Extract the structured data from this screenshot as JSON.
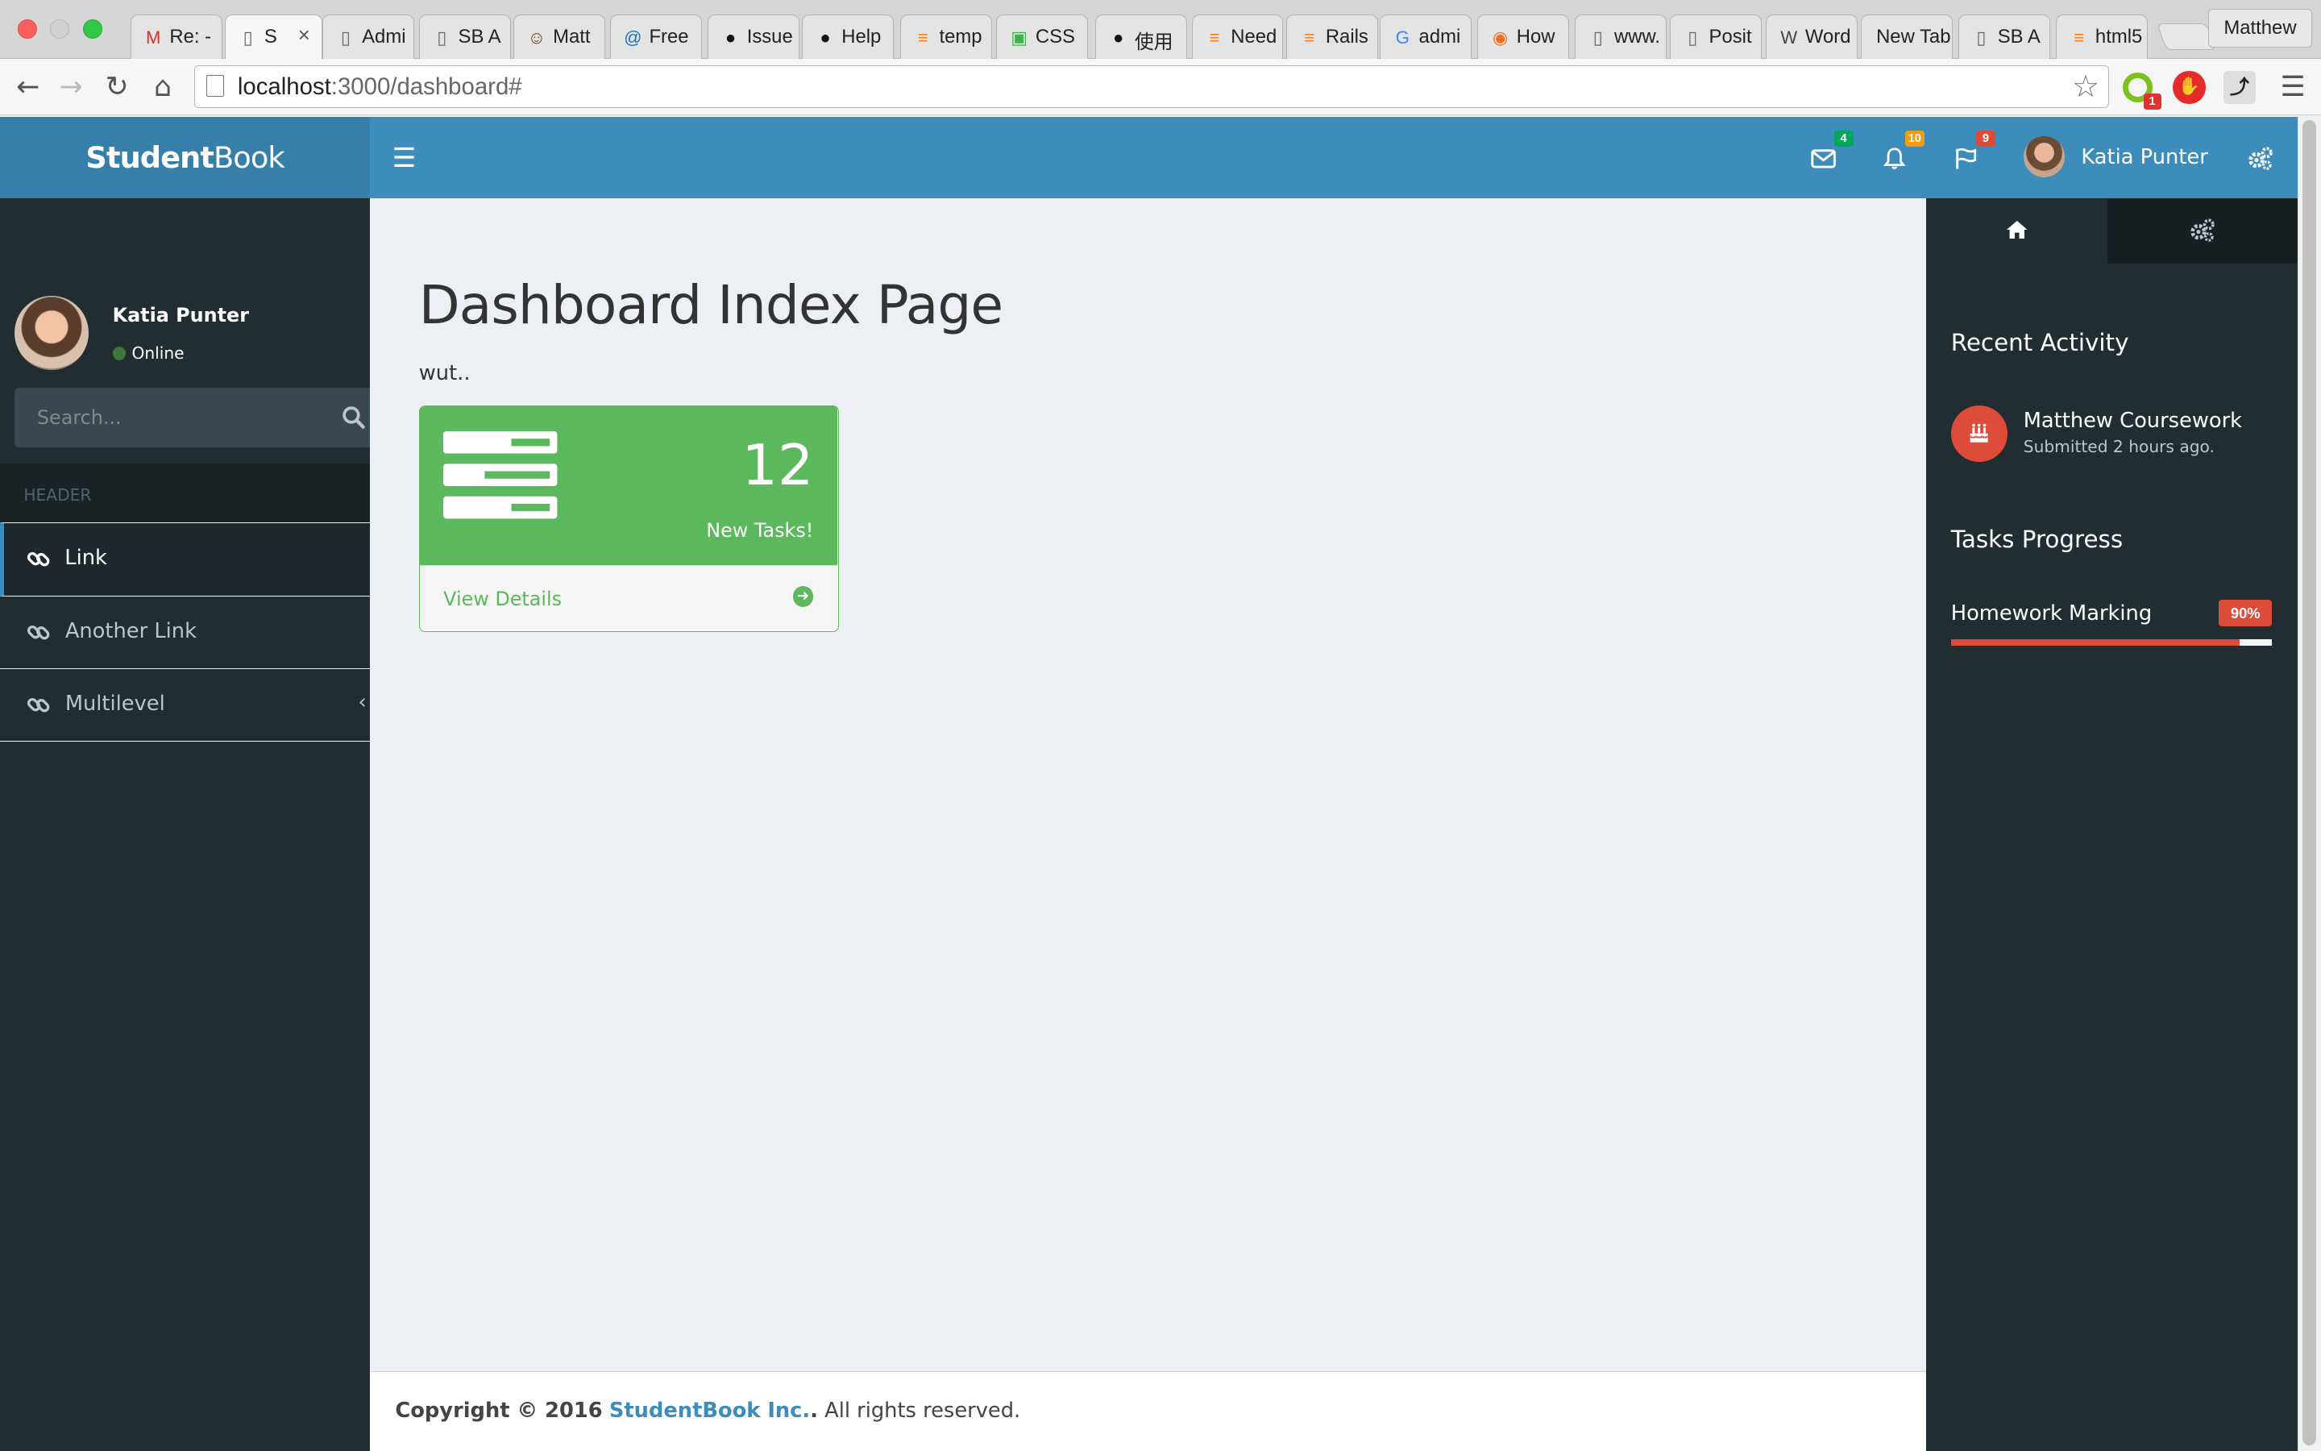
{
  "browser": {
    "tabs": [
      {
        "label": "Re: -",
        "icon": "gmail-icon"
      },
      {
        "label": "S",
        "icon": "page-icon",
        "active": true
      },
      {
        "label": "Admi",
        "icon": "page-icon"
      },
      {
        "label": "SB A",
        "icon": "page-icon"
      },
      {
        "label": "Matt",
        "icon": "avatar-icon"
      },
      {
        "label": "Free",
        "icon": "at-icon"
      },
      {
        "label": "Issue",
        "icon": "github-icon"
      },
      {
        "label": "Help",
        "icon": "github-icon"
      },
      {
        "label": "temp",
        "icon": "stackoverflow-icon"
      },
      {
        "label": "CSS",
        "icon": "css-icon"
      },
      {
        "label": "使用",
        "icon": "github-icon"
      },
      {
        "label": "Need",
        "icon": "stackoverflow-icon"
      },
      {
        "label": "Rails",
        "icon": "stackoverflow-icon"
      },
      {
        "label": "admi",
        "icon": "google-icon"
      },
      {
        "label": "How",
        "icon": "orange-icon"
      },
      {
        "label": "www.",
        "icon": "page-icon"
      },
      {
        "label": "Posit",
        "icon": "page-icon"
      },
      {
        "label": "Word",
        "icon": "wordpress-icon"
      },
      {
        "label": "New Tab",
        "icon": ""
      },
      {
        "label": "SB A",
        "icon": "page-icon"
      },
      {
        "label": "html5",
        "icon": "stackoverflow-icon"
      }
    ],
    "profile": "Matthew",
    "url_host": "localhost",
    "url_rest": ":3000/dashboard#",
    "ext_badge": "1"
  },
  "header": {
    "logo_bold": "Student",
    "logo_light": "Book",
    "messages_count": "4",
    "notifications_count": "10",
    "tasks_count": "9",
    "user_name": "Katia Punter",
    "colors": {
      "header": "#3c8dbc",
      "logo": "#367fa9",
      "green": "#00a65a",
      "yellow": "#f39c12",
      "red": "#dd4b39"
    }
  },
  "sidebar": {
    "user_name": "Katia Punter",
    "status": "Online",
    "search_placeholder": "Search...",
    "header": "HEADER",
    "items": [
      {
        "label": "Link",
        "active": true
      },
      {
        "label": "Another Link"
      },
      {
        "label": "Multilevel",
        "has_children": true
      }
    ]
  },
  "main": {
    "title": "Dashboard Index Page",
    "subtitle": "wut..",
    "panel": {
      "count": "12",
      "caption": "New Tasks!",
      "link": "View Details",
      "color": "#5cb85c"
    }
  },
  "footer": {
    "copyright": "Copyright © 2016",
    "brand": "StudentBook Inc.",
    "dot": ".",
    "rights": "All rights reserved."
  },
  "control_sidebar": {
    "recent_activity_title": "Recent Activity",
    "activity": {
      "title": "Matthew Coursework",
      "subtitle": "Submitted 2 hours ago.",
      "icon": "birthday-cake-icon"
    },
    "tasks_progress_title": "Tasks Progress",
    "task": {
      "name": "Homework Marking",
      "percent_label": "90%",
      "progress": 0.9
    }
  }
}
